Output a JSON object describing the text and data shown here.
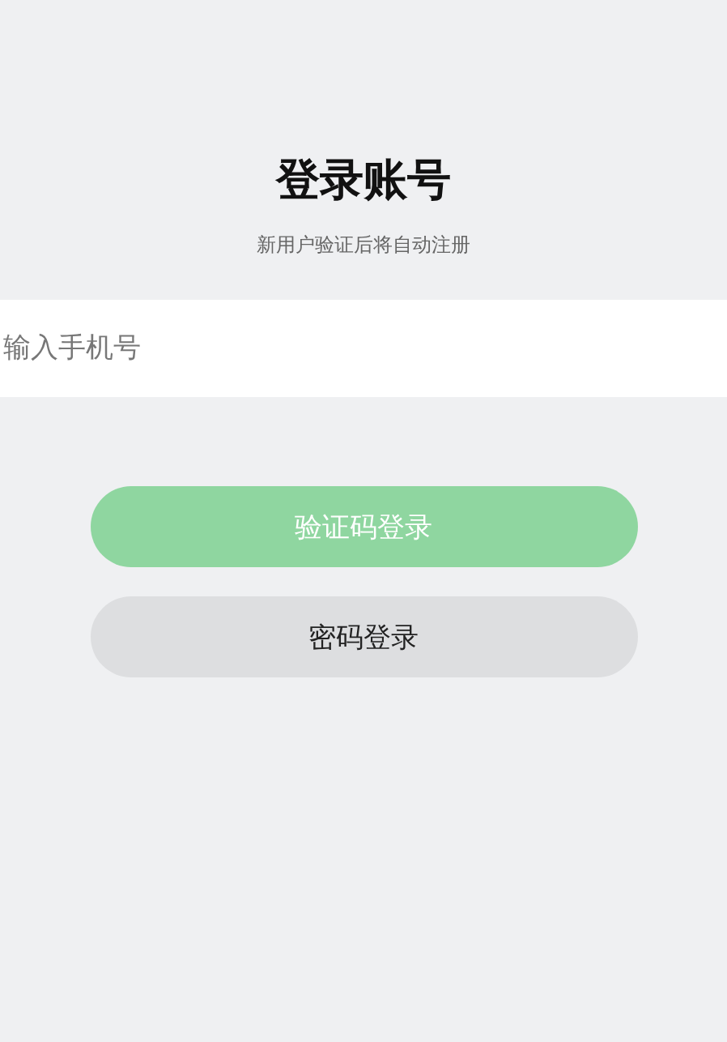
{
  "title": "登录账号",
  "subtitle": "新用户验证后将自动注册",
  "phone_field": {
    "placeholder": "输入手机号"
  },
  "buttons": [
    {
      "label": "验证码登录",
      "kind": "primary",
      "disabled": true
    },
    {
      "label": "密码登录",
      "kind": "secondary",
      "disabled": false
    }
  ]
}
